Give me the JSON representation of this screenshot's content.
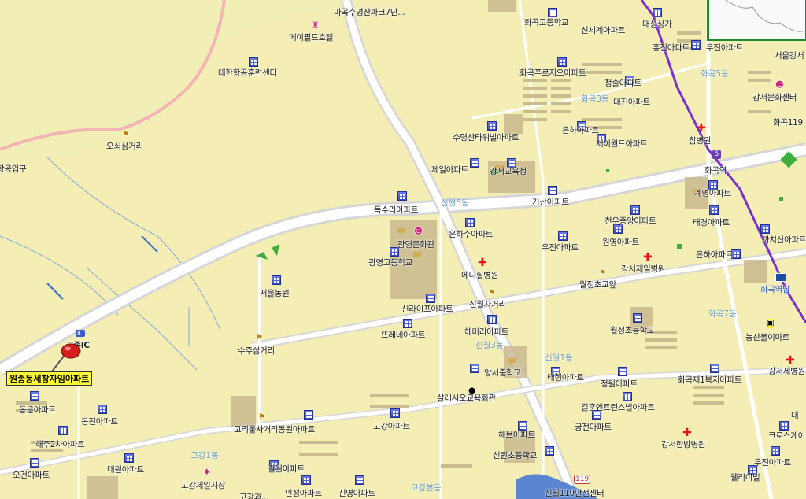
{
  "map": {
    "pin_label": "원종동세창자임아파트",
    "ic_badge": "IC",
    "ic_label": "고종IC",
    "route_badge": "119",
    "line_badge": "5",
    "areas": [
      {
        "id": "hwagok5",
        "text": "화곡5동"
      },
      {
        "id": "hwagok3",
        "text": "화곡3동"
      },
      {
        "id": "sinwol5",
        "text": "신월5동"
      },
      {
        "id": "hwagok7",
        "text": "화곡7동"
      },
      {
        "id": "sinwol3",
        "text": "신월3동"
      },
      {
        "id": "sinwol1",
        "text": "신월1동"
      },
      {
        "id": "gogang1",
        "text": "고강1동"
      },
      {
        "id": "gogangbon",
        "text": "고강본동"
      }
    ],
    "labels": [
      {
        "id": "mapo_park",
        "text": "마곡수명산파크7단..."
      },
      {
        "id": "hwagok_high",
        "text": "화곡고등학교"
      },
      {
        "id": "sinsegye",
        "text": "신세계아파트"
      },
      {
        "id": "daesung",
        "text": "대성상가"
      },
      {
        "id": "hongjin",
        "text": "홍진아파트"
      },
      {
        "id": "woojin_top",
        "text": "우진아파트"
      },
      {
        "id": "seoul_gangseo",
        "text": "서울강서"
      },
      {
        "id": "maple_hotel",
        "text": "메이필드호텔"
      },
      {
        "id": "kac_training",
        "text": "대한항공훈련센터"
      },
      {
        "id": "hwagok_prugio",
        "text": "화곡푸르지오아파트"
      },
      {
        "id": "chungsol",
        "text": "청솔아파트"
      },
      {
        "id": "daejin",
        "text": "대진아파트"
      },
      {
        "id": "gangseo_culture",
        "text": "강서문화센터"
      },
      {
        "id": "hwagok119",
        "text": "화곡119"
      },
      {
        "id": "osoi",
        "text": "오쇠삼거리"
      },
      {
        "id": "hanggong",
        "text": "항공입구"
      },
      {
        "id": "eunha_1",
        "text": "은하아파트"
      },
      {
        "id": "samyang_hosp",
        "text": "참병원"
      },
      {
        "id": "jeil_world",
        "text": "제이월드아파트"
      },
      {
        "id": "sumyeongsan",
        "text": "수명산타워빌아파트"
      },
      {
        "id": "jeil_apt",
        "text": "제일아파트"
      },
      {
        "id": "gangseo_edu",
        "text": "강서교육청"
      },
      {
        "id": "hwagok_stn",
        "text": "화곡역"
      },
      {
        "id": "gyemyeong",
        "text": "계명아파트"
      },
      {
        "id": "geosan",
        "text": "거산아파트"
      },
      {
        "id": "doksuri",
        "text": "독수리아파트"
      },
      {
        "id": "cheonwoo",
        "text": "천우중앙아파트"
      },
      {
        "id": "taegyeong",
        "text": "태경아파트"
      },
      {
        "id": "eunhasu",
        "text": "은하수아파트"
      },
      {
        "id": "wonyeong",
        "text": "원영아파트"
      },
      {
        "id": "kkachisan",
        "text": "까치산아파트"
      },
      {
        "id": "gwangyeong_hall",
        "text": "광영문화관"
      },
      {
        "id": "woojin_mid",
        "text": "우진아파트"
      },
      {
        "id": "eunha_2",
        "text": "은하아파트"
      },
      {
        "id": "gwangyeong_high",
        "text": "광영고등학교"
      },
      {
        "id": "gangseo_jeil_hosp",
        "text": "강서제일병원"
      },
      {
        "id": "medihill",
        "text": "메디힐병원"
      },
      {
        "id": "seoul_farm",
        "text": "서울농원"
      },
      {
        "id": "wolgyeong_elem_front",
        "text": "월정초교앞"
      },
      {
        "id": "hwagok_nae",
        "text": "화곡역남"
      },
      {
        "id": "silraipeu",
        "text": "신라이프아파트"
      },
      {
        "id": "sinwol_junction",
        "text": "신월사거리"
      },
      {
        "id": "hemiri",
        "text": "헤미리아파트"
      },
      {
        "id": "wolgyeong_elem",
        "text": "월정초등학교"
      },
      {
        "id": "nonghyup_mart",
        "text": "농산물이마트"
      },
      {
        "id": "ttreune",
        "text": "뜨레네아파트"
      },
      {
        "id": "suju_junction",
        "text": "수주삼거리"
      },
      {
        "id": "yangseo_middle",
        "text": "양서중학교"
      },
      {
        "id": "gangseo_hosp",
        "text": "강서세병원"
      },
      {
        "id": "taehyeong",
        "text": "태형아파트"
      },
      {
        "id": "hwagok_welfare",
        "text": "화곡제1복지아파트"
      },
      {
        "id": "jeongwon",
        "text": "정원아파트"
      },
      {
        "id": "dongmun",
        "text": "동문아파트"
      },
      {
        "id": "dongjin",
        "text": "동진아파트"
      },
      {
        "id": "salesian",
        "text": "살레시오교육회관"
      },
      {
        "id": "gilhyeon",
        "text": "길훈엔트런스빌아파트"
      },
      {
        "id": "gogang_apt",
        "text": "고강아파트"
      },
      {
        "id": "gunjin",
        "text": "궁전아파트"
      },
      {
        "id": "gori_dongwon",
        "text": "고리울사거리동원아파트"
      },
      {
        "id": "haebeu",
        "text": "해브아파트"
      },
      {
        "id": "crossgate",
        "text": "크로스게이"
      },
      {
        "id": "haeju",
        "text": "해주2차아파트"
      },
      {
        "id": "gangseo_hanbang",
        "text": "강서한방병원"
      },
      {
        "id": "sinwon_elem",
        "text": "신원초등학교"
      },
      {
        "id": "daewon",
        "text": "대원아파트"
      },
      {
        "id": "geolwol",
        "text": "걸월아파트"
      },
      {
        "id": "ogeon",
        "text": "오건아파트"
      },
      {
        "id": "ujin_bottom",
        "text": "우진아파트"
      },
      {
        "id": "wellivil",
        "text": "웰리이빌"
      },
      {
        "id": "gogang_market",
        "text": "고강제일시장"
      },
      {
        "id": "gogang_gwa",
        "text": "고강과..."
      },
      {
        "id": "insung",
        "text": "인성아파트"
      },
      {
        "id": "jinyeong",
        "text": "진영아파트"
      },
      {
        "id": "sinwol119",
        "text": "신월119안전센터"
      },
      {
        "id": "dae_edge",
        "text": "대"
      }
    ]
  }
}
